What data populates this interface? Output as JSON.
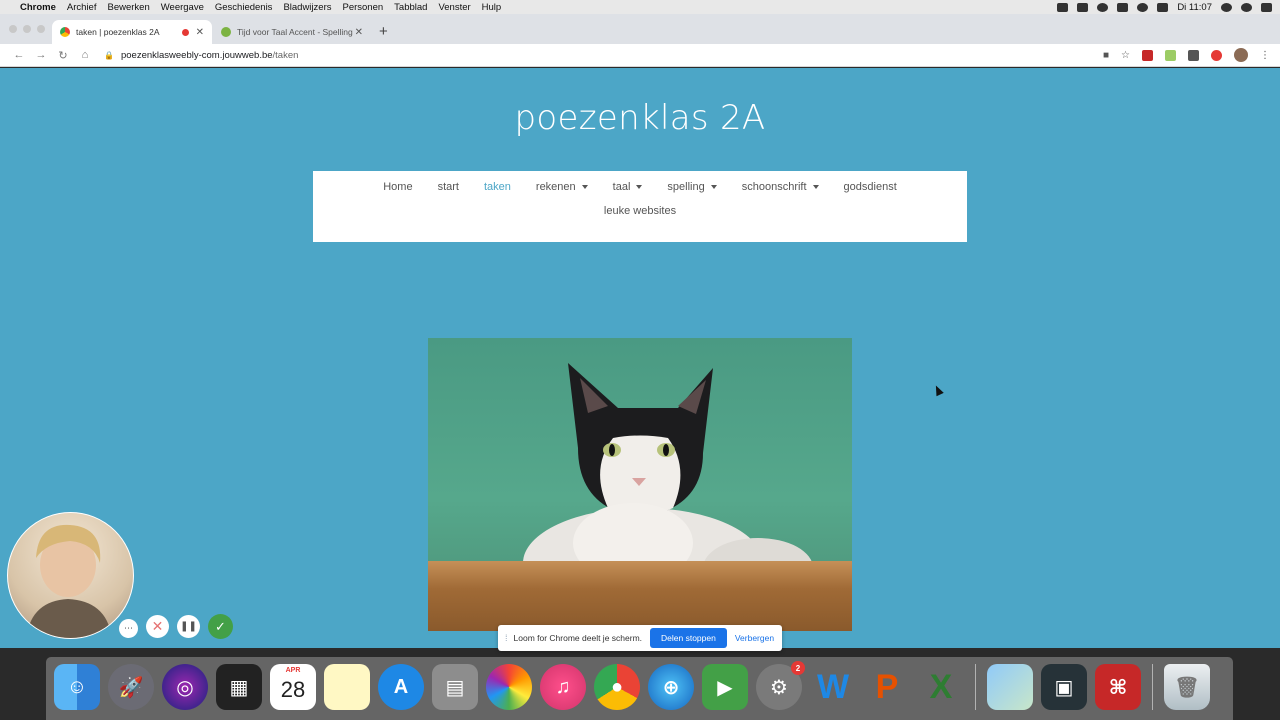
{
  "menubar": {
    "items": [
      "Chrome",
      "Archief",
      "Bewerken",
      "Weergave",
      "Geschiedenis",
      "Bladwijzers",
      "Personen",
      "Tabblad",
      "Venster",
      "Hulp"
    ],
    "clock": "Di 11:07"
  },
  "browser": {
    "tabs": [
      {
        "title": "taken | poezenklas 2A"
      },
      {
        "title": "Tijd voor Taal Accent - Spelling"
      }
    ],
    "url_domain": "poezenklasweebly-com.jouwweb.be",
    "url_path": "/taken"
  },
  "site": {
    "title": "poezenklas 2A",
    "nav": [
      {
        "label": "Home"
      },
      {
        "label": "start"
      },
      {
        "label": "taken"
      },
      {
        "label": "rekenen"
      },
      {
        "label": "taal"
      },
      {
        "label": "spelling"
      },
      {
        "label": "schoonschrift"
      },
      {
        "label": "godsdienst"
      },
      {
        "label": "leuke websites"
      }
    ]
  },
  "loom": {
    "message": "Loom for Chrome deelt je scherm.",
    "stop_label": "Delen stoppen",
    "hide_label": "Verbergen"
  },
  "dock": {
    "calendar_month": "APR",
    "calendar_day": "28",
    "prefs_badge": "2"
  },
  "colors": {
    "page_bg": "#4ca6c7",
    "nav_active": "#4ca6c7",
    "loom_blue": "#1a73e8",
    "loom_done": "#43a047"
  }
}
